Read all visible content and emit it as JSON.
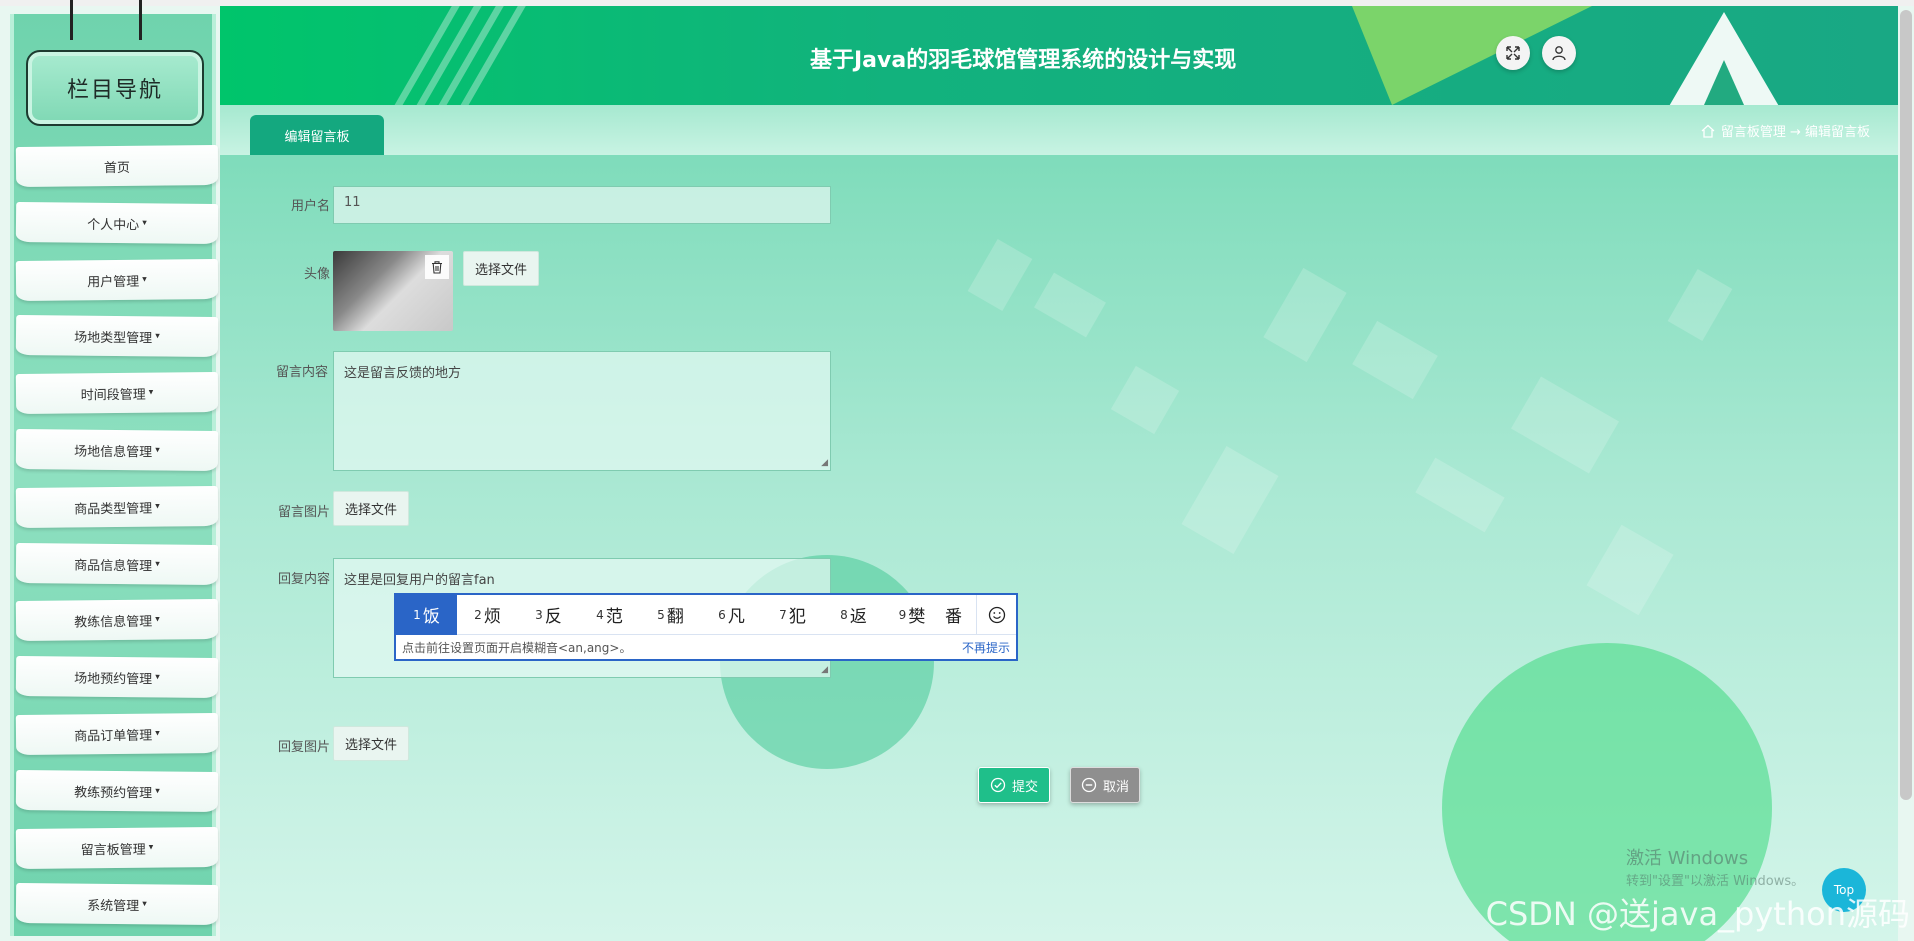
{
  "sidebar": {
    "title": "栏目导航",
    "items": [
      {
        "label": "首页",
        "caret": ""
      },
      {
        "label": "个人中心",
        "caret": "▾"
      },
      {
        "label": "用户管理",
        "caret": "▾"
      },
      {
        "label": "场地类型管理",
        "caret": "▾"
      },
      {
        "label": "时间段管理",
        "caret": "▾"
      },
      {
        "label": "场地信息管理",
        "caret": "▾"
      },
      {
        "label": "商品类型管理",
        "caret": "▾"
      },
      {
        "label": "商品信息管理",
        "caret": "▾"
      },
      {
        "label": "教练信息管理",
        "caret": "▾"
      },
      {
        "label": "场地预约管理",
        "caret": "▾"
      },
      {
        "label": "商品订单管理",
        "caret": "▾"
      },
      {
        "label": "教练预约管理",
        "caret": "▾"
      },
      {
        "label": "留言板管理",
        "caret": "▾"
      },
      {
        "label": "系统管理",
        "caret": "▾"
      }
    ]
  },
  "header": {
    "title": "基于Java的羽毛球馆管理系统的设计与实现",
    "fullscreen_icon": "expand-icon",
    "user_icon": "user-icon"
  },
  "tabbar": {
    "active_tab": "编辑留言板",
    "breadcrumb": "留言板管理 → 编辑留言板"
  },
  "form": {
    "username_label": "用户名",
    "username_value": "11",
    "avatar_label": "头像",
    "avatar_choose": "选择文件",
    "message_label": "留言内容",
    "message_value": "这是留言反馈的地方",
    "message_image_label": "留言图片",
    "message_image_choose": "选择文件",
    "reply_label": "回复内容",
    "reply_value": "这里是回复用户的留言fan",
    "reply_image_label": "回复图片",
    "reply_image_choose": "选择文件",
    "submit_label": "提交",
    "cancel_label": "取消"
  },
  "ime": {
    "candidates": [
      {
        "n": "1",
        "c": "饭"
      },
      {
        "n": "2",
        "c": "烦"
      },
      {
        "n": "3",
        "c": "反"
      },
      {
        "n": "4",
        "c": "范"
      },
      {
        "n": "5",
        "c": "翻"
      },
      {
        "n": "6",
        "c": "凡"
      },
      {
        "n": "7",
        "c": "犯"
      },
      {
        "n": "8",
        "c": "返"
      },
      {
        "n": "9",
        "c": "樊"
      },
      {
        "n": "",
        "c": "番"
      }
    ],
    "tip": "点击前往设置页面开启模糊音<an,ang>。",
    "dismiss": "不再提示"
  },
  "overlay": {
    "win_activate": "激活 Windows",
    "win_activate_sub": "转到\"设置\"以激活 Windows。",
    "csdn": "CSDN @送java_python源码",
    "top": "Top"
  },
  "colors": {
    "primary": "#14a87f",
    "submit": "#1fbf8a",
    "cancel": "#8f8f8f",
    "ime_accent": "#2a65c7"
  }
}
